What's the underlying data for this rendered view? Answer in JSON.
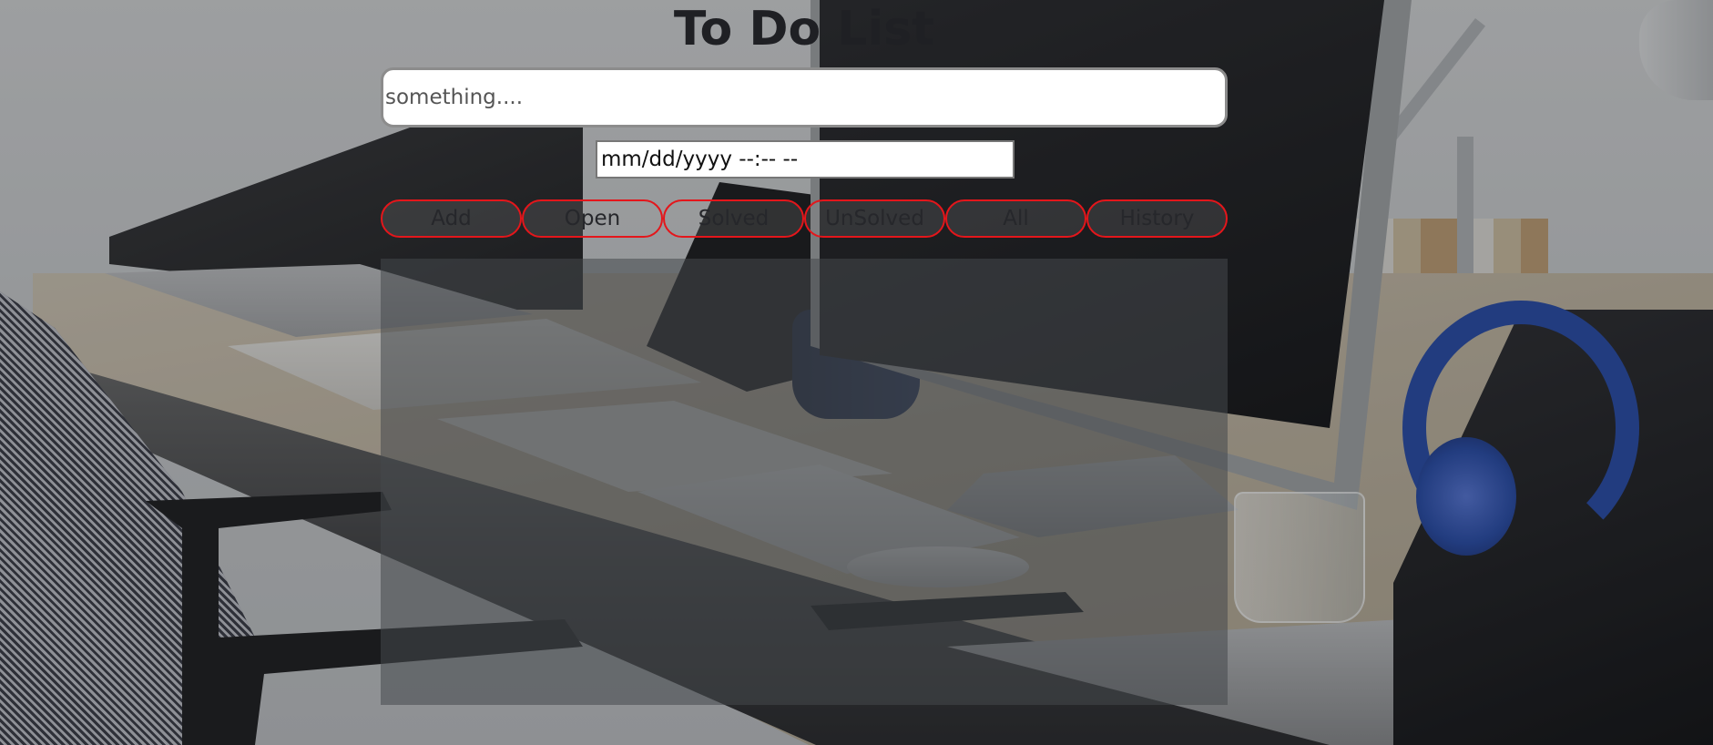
{
  "app": {
    "title": "To Do List"
  },
  "task_input": {
    "placeholder": "something....",
    "value": ""
  },
  "date_input": {
    "display_value": "mm/dd/yyyy --:-- --"
  },
  "buttons": {
    "add": "Add",
    "open": "Open",
    "solved": "Solved",
    "unsolved": "UnSolved",
    "all": "All",
    "history": "History"
  },
  "colors": {
    "button_border": "#e4161b",
    "title_text": "#1f2024",
    "panel_background": "rgba(70,72,76,0.55)"
  },
  "background": {
    "description_icon": "office-desk-photo"
  },
  "task_list": {
    "items": []
  }
}
